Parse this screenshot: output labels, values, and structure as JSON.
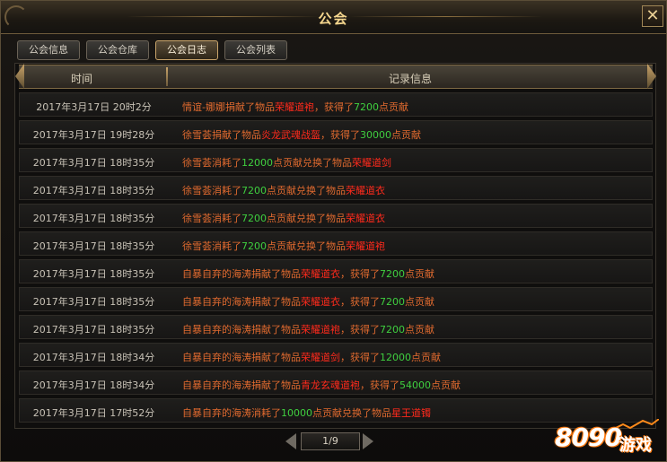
{
  "window": {
    "title": "公会",
    "close_label": "✕"
  },
  "tabs": [
    {
      "label": "公会信息"
    },
    {
      "label": "公会仓库"
    },
    {
      "label": "公会日志"
    },
    {
      "label": "公会列表"
    }
  ],
  "active_tab": "公会日志",
  "table": {
    "headers": {
      "time": "时间",
      "log": "记录信息"
    },
    "rows": [
      {
        "time": "2017年3月17日  20时2分",
        "parts": [
          {
            "t": "情谊-娜娜捐献了物品",
            "c": "normal"
          },
          {
            "t": "荣耀道袍",
            "c": "item"
          },
          {
            "t": "，获得了",
            "c": "normal"
          },
          {
            "t": "7200",
            "c": "num"
          },
          {
            "t": "点贡献",
            "c": "normal"
          }
        ]
      },
      {
        "time": "2017年3月17日  19时28分",
        "parts": [
          {
            "t": "徐雪荟捐献了物品",
            "c": "normal"
          },
          {
            "t": "炎龙武魂战盔",
            "c": "item"
          },
          {
            "t": "，获得了",
            "c": "normal"
          },
          {
            "t": "30000",
            "c": "num"
          },
          {
            "t": "点贡献",
            "c": "normal"
          }
        ]
      },
      {
        "time": "2017年3月17日  18时35分",
        "parts": [
          {
            "t": "徐雪荟消耗了",
            "c": "normal"
          },
          {
            "t": "12000",
            "c": "num"
          },
          {
            "t": "点贡献兑换了物品",
            "c": "normal"
          },
          {
            "t": "荣耀道剑",
            "c": "item"
          }
        ]
      },
      {
        "time": "2017年3月17日  18时35分",
        "parts": [
          {
            "t": "徐雪荟消耗了",
            "c": "normal"
          },
          {
            "t": "7200",
            "c": "num"
          },
          {
            "t": "点贡献兑换了物品",
            "c": "normal"
          },
          {
            "t": "荣耀道衣",
            "c": "item"
          }
        ]
      },
      {
        "time": "2017年3月17日  18时35分",
        "parts": [
          {
            "t": "徐雪荟消耗了",
            "c": "normal"
          },
          {
            "t": "7200",
            "c": "num"
          },
          {
            "t": "点贡献兑换了物品",
            "c": "normal"
          },
          {
            "t": "荣耀道衣",
            "c": "item"
          }
        ]
      },
      {
        "time": "2017年3月17日  18时35分",
        "parts": [
          {
            "t": "徐雪荟消耗了",
            "c": "normal"
          },
          {
            "t": "7200",
            "c": "num"
          },
          {
            "t": "点贡献兑换了物品",
            "c": "normal"
          },
          {
            "t": "荣耀道袍",
            "c": "item"
          }
        ]
      },
      {
        "time": "2017年3月17日  18时35分",
        "parts": [
          {
            "t": "自暴自弃的海涛捐献了物品",
            "c": "normal"
          },
          {
            "t": "荣耀道衣",
            "c": "item"
          },
          {
            "t": "，获得了",
            "c": "normal"
          },
          {
            "t": "7200",
            "c": "num"
          },
          {
            "t": "点贡献",
            "c": "normal"
          }
        ]
      },
      {
        "time": "2017年3月17日  18时35分",
        "parts": [
          {
            "t": "自暴自弃的海涛捐献了物品",
            "c": "normal"
          },
          {
            "t": "荣耀道衣",
            "c": "item"
          },
          {
            "t": "，获得了",
            "c": "normal"
          },
          {
            "t": "7200",
            "c": "num"
          },
          {
            "t": "点贡献",
            "c": "normal"
          }
        ]
      },
      {
        "time": "2017年3月17日  18时35分",
        "parts": [
          {
            "t": "自暴自弃的海涛捐献了物品",
            "c": "normal"
          },
          {
            "t": "荣耀道袍",
            "c": "item"
          },
          {
            "t": "，获得了",
            "c": "normal"
          },
          {
            "t": "7200",
            "c": "num"
          },
          {
            "t": "点贡献",
            "c": "normal"
          }
        ]
      },
      {
        "time": "2017年3月17日  18时34分",
        "parts": [
          {
            "t": "自暴自弃的海涛捐献了物品",
            "c": "normal"
          },
          {
            "t": "荣耀道剑",
            "c": "item"
          },
          {
            "t": "，获得了",
            "c": "normal"
          },
          {
            "t": "12000",
            "c": "num"
          },
          {
            "t": "点贡献",
            "c": "normal"
          }
        ]
      },
      {
        "time": "2017年3月17日  18时34分",
        "parts": [
          {
            "t": "自暴自弃的海涛捐献了物品",
            "c": "normal"
          },
          {
            "t": "青龙玄魂道袍",
            "c": "item"
          },
          {
            "t": "，获得了",
            "c": "normal"
          },
          {
            "t": "54000",
            "c": "num"
          },
          {
            "t": "点贡献",
            "c": "normal"
          }
        ]
      },
      {
        "time": "2017年3月17日  17时52分",
        "parts": [
          {
            "t": "自暴自弃的海涛消耗了",
            "c": "normal"
          },
          {
            "t": "10000",
            "c": "num"
          },
          {
            "t": "点贡献兑换了物品",
            "c": "normal"
          },
          {
            "t": "星王道镯",
            "c": "item"
          }
        ]
      }
    ]
  },
  "pager": {
    "label": "1/9"
  },
  "watermark": {
    "digits": "8090",
    "word": "游戏"
  },
  "colors": {
    "normal": "#e06a2f",
    "item": "#ff2a1c",
    "num": "#3fcf3f",
    "title": "#f6d78e"
  }
}
